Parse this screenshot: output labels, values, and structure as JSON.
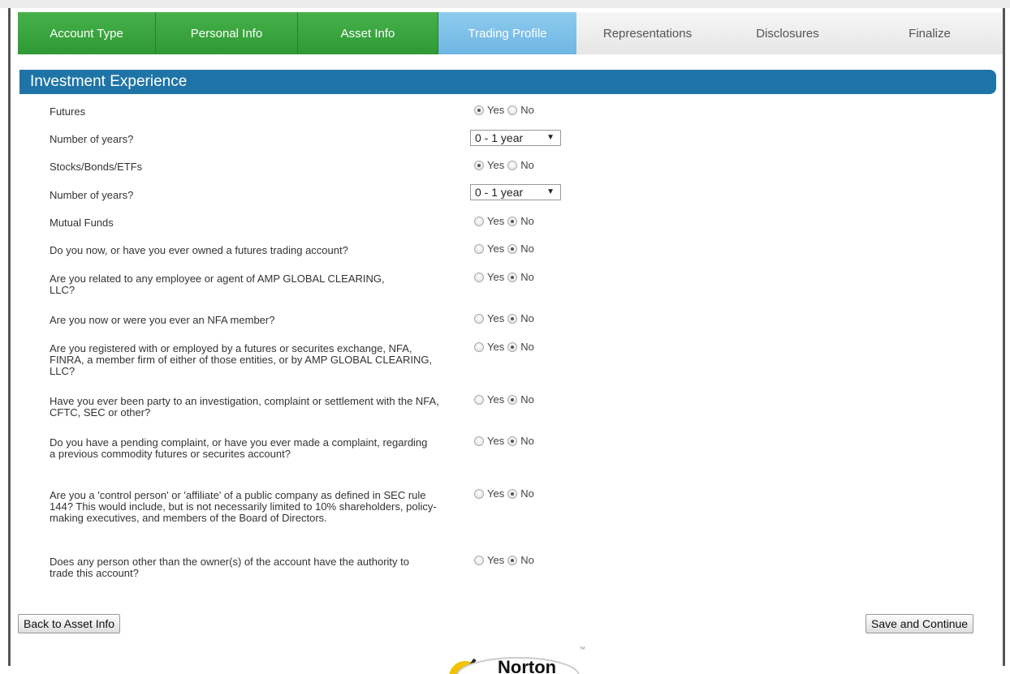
{
  "tabs": [
    {
      "label": "Account Type",
      "state": "done"
    },
    {
      "label": "Personal Info",
      "state": "done"
    },
    {
      "label": "Asset Info",
      "state": "done"
    },
    {
      "label": "Trading Profile",
      "state": "active"
    },
    {
      "label": "Representations",
      "state": "todo"
    },
    {
      "label": "Disclosures",
      "state": "todo"
    },
    {
      "label": "Finalize",
      "state": "todo"
    }
  ],
  "section": {
    "title": "Investment Experience"
  },
  "questions": [
    {
      "label": "Futures",
      "type": "radio",
      "value": "Yes"
    },
    {
      "label": "Number of years?",
      "type": "select",
      "value": "0 - 1 year"
    },
    {
      "label": "Stocks/Bonds/ETFs",
      "type": "radio",
      "value": "Yes"
    },
    {
      "label": "Number of years?",
      "type": "select",
      "value": "0 - 1 year"
    },
    {
      "label": "Mutual Funds",
      "type": "radio",
      "value": "No"
    },
    {
      "label": "Do you now, or have you ever owned a futures trading account?",
      "type": "radio",
      "value": "No"
    },
    {
      "label": "Are you related to any employee or agent of AMP GLOBAL CLEARING, LLC?",
      "type": "radio",
      "value": "No"
    },
    {
      "label": "Are you now or were you ever an NFA member?",
      "type": "radio",
      "value": "No"
    },
    {
      "label": "Are you registered with or employed by a futures or securites exchange, NFA, FINRA, a member firm of either of those entities, or by AMP GLOBAL CLEARING, LLC?",
      "type": "radio",
      "value": "No"
    },
    {
      "label": "Have you ever been party to an investigation, complaint or settlement with the NFA, CFTC, SEC or other?",
      "type": "radio",
      "value": "No"
    },
    {
      "label": "Do you have a pending complaint, or have you ever made a complaint, regarding a previous commodity futures or securites account?",
      "type": "radio",
      "value": "No"
    },
    {
      "label": "Are you a 'control person' or 'affiliate' of a public company as defined in SEC rule 144? This would include, but is not necessarily limited to 10% shareholders, policy-making executives, and members of the Board of Directors.",
      "type": "radio",
      "value": "No"
    },
    {
      "label": "Does any person other than the owner(s) of the account have the authority to trade this account?",
      "type": "radio",
      "value": "No"
    }
  ],
  "radio_labels": {
    "yes": "Yes",
    "no": "No"
  },
  "buttons": {
    "back": "Back to Asset Info",
    "save": "Save and Continue"
  },
  "colors": {
    "tab_done": "#3aa63f",
    "tab_active": "#7fc1ea",
    "section_header": "#1f74a7"
  },
  "logo": {
    "name": "Norton"
  }
}
